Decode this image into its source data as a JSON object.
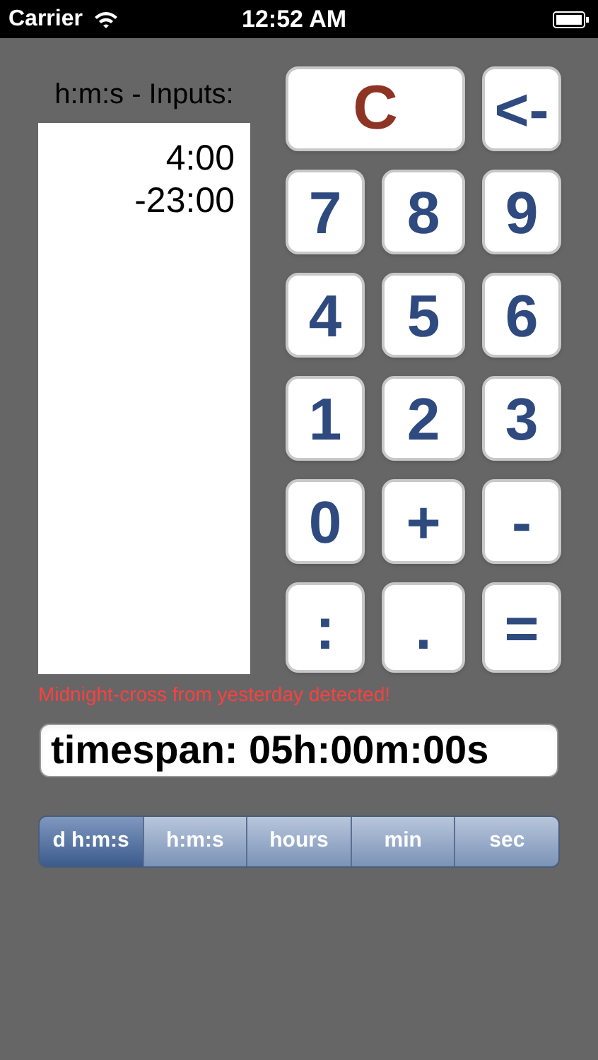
{
  "status_bar": {
    "carrier": "Carrier",
    "time": "12:52 AM"
  },
  "inputs": {
    "label": "h:m:s - Inputs:",
    "lines": [
      "4:00",
      "-23:00"
    ]
  },
  "keypad": [
    {
      "label": "C",
      "kind": "clear"
    },
    {
      "label": "<-",
      "kind": "key"
    },
    {
      "label": "7",
      "kind": "key"
    },
    {
      "label": "8",
      "kind": "key"
    },
    {
      "label": "9",
      "kind": "key"
    },
    {
      "label": "4",
      "kind": "key"
    },
    {
      "label": "5",
      "kind": "key"
    },
    {
      "label": "6",
      "kind": "key"
    },
    {
      "label": "1",
      "kind": "key"
    },
    {
      "label": "2",
      "kind": "key"
    },
    {
      "label": "3",
      "kind": "key"
    },
    {
      "label": "0",
      "kind": "key"
    },
    {
      "label": "+",
      "kind": "key"
    },
    {
      "label": "-",
      "kind": "key"
    },
    {
      "label": ":",
      "kind": "key"
    },
    {
      "label": ".",
      "kind": "key"
    },
    {
      "label": "=",
      "kind": "key"
    }
  ],
  "warning": "Midnight-cross from yesterday detected!",
  "result": "timespan: 05h:00m:00s",
  "format_tabs": [
    {
      "label": "d h:m:s",
      "selected": true
    },
    {
      "label": "h:m:s",
      "selected": false
    },
    {
      "label": "hours",
      "selected": false
    },
    {
      "label": "min",
      "selected": false
    },
    {
      "label": "sec",
      "selected": false
    }
  ]
}
